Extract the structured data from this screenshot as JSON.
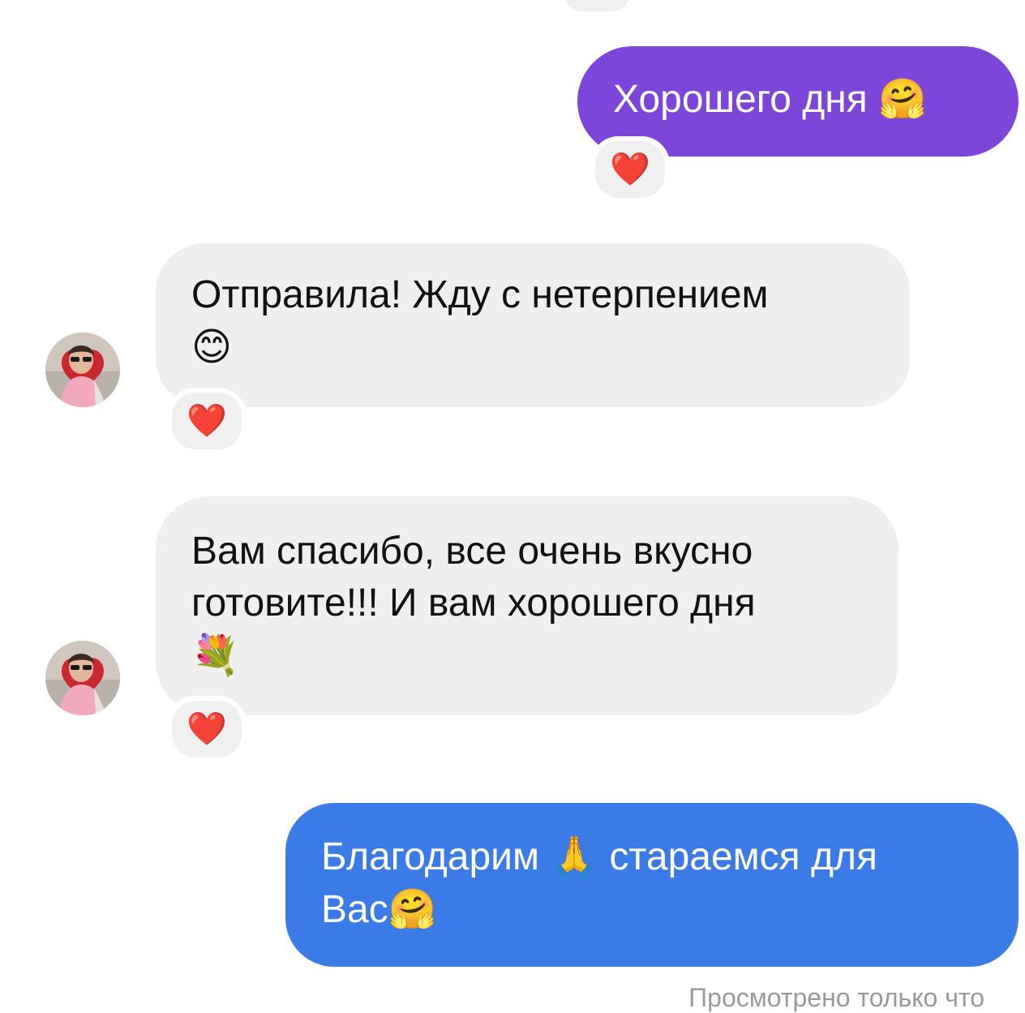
{
  "messages": [
    {
      "id": "msg1",
      "direction": "outgoing",
      "text": "Хорошего дня",
      "emoji": "🤗",
      "reaction": "❤️"
    },
    {
      "id": "msg2",
      "direction": "incoming",
      "line1": "Отправила! Жду с нетерпением",
      "emoji": "😊",
      "reaction": "❤️"
    },
    {
      "id": "msg3",
      "direction": "incoming",
      "line1": "Вам спасибо, все очень вкусно",
      "line2": "готовите!!! И вам хорошего дня",
      "emoji": "💐",
      "reaction": "❤️"
    },
    {
      "id": "msg4",
      "direction": "outgoing",
      "line1_text_a": "Благодарим",
      "line1_emoji": "🙏",
      "line1_text_b": "стараемся для",
      "line2_text": "Вас",
      "line2_emoji": "🤗"
    }
  ],
  "status": {
    "seen_text": "Просмотрено только что"
  },
  "colors": {
    "outgoing_purple": "#7e45db",
    "outgoing_blue": "#3b7be8",
    "incoming_gray": "#efefef",
    "heart_red": "#e0162b"
  },
  "icons": {
    "reaction": "heart-icon",
    "avatar": "user-avatar-photo"
  }
}
